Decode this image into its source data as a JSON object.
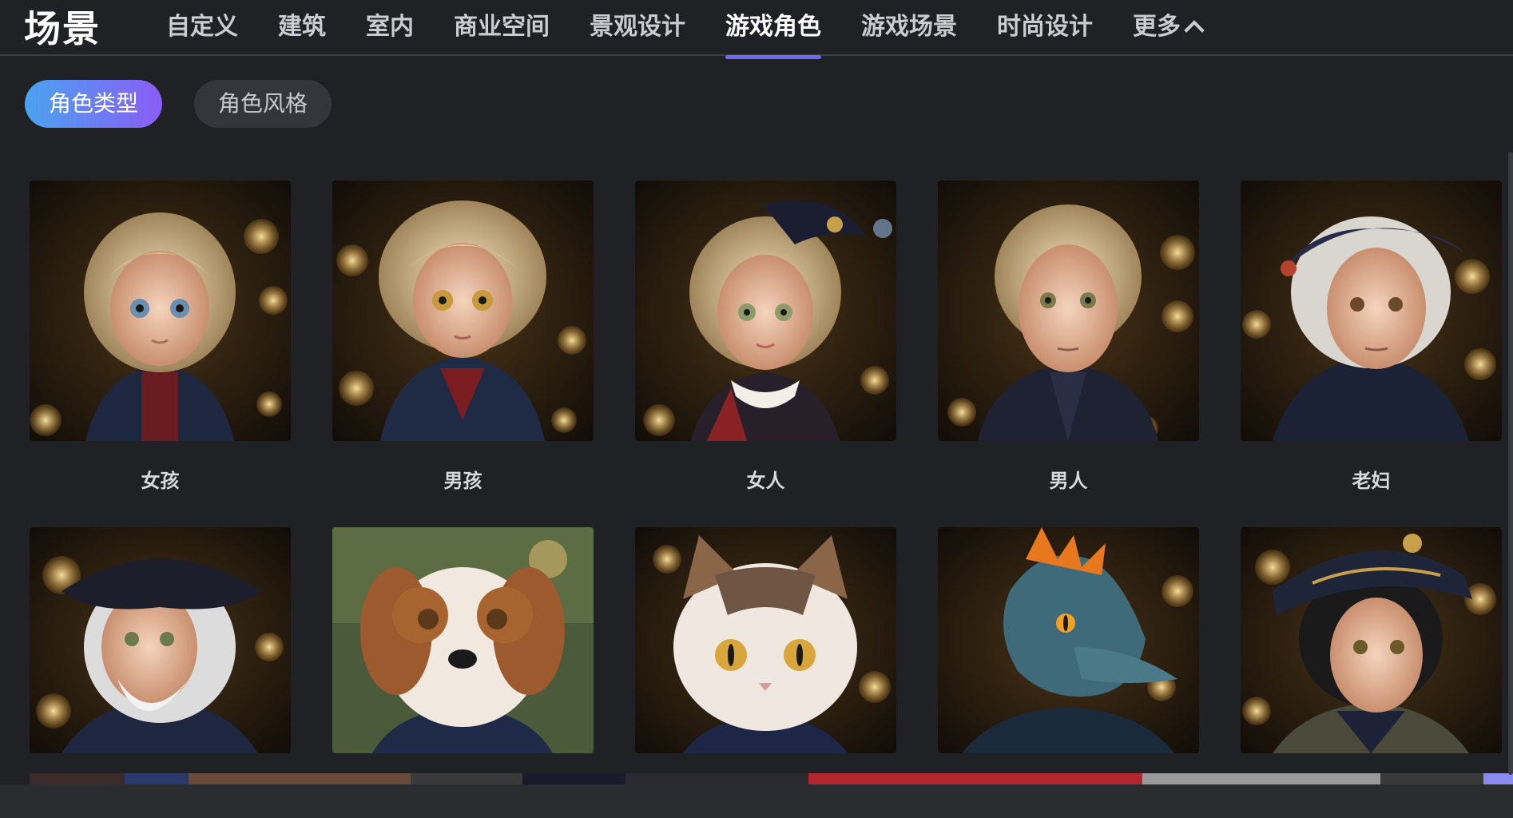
{
  "header": {
    "title": "场景",
    "tabs": [
      {
        "label": "自定义",
        "active": false
      },
      {
        "label": "建筑",
        "active": false
      },
      {
        "label": "室内",
        "active": false
      },
      {
        "label": "商业空间",
        "active": false
      },
      {
        "label": "景观设计",
        "active": false
      },
      {
        "label": "游戏角色",
        "active": true
      },
      {
        "label": "游戏场景",
        "active": false
      },
      {
        "label": "时尚设计",
        "active": false
      },
      {
        "label": "更多",
        "active": false
      }
    ],
    "accent": "#6b6cf6"
  },
  "filters": [
    {
      "label": "角色类型",
      "active": true
    },
    {
      "label": "角色风格",
      "active": false
    }
  ],
  "cards_row1": [
    {
      "label": "女孩",
      "subject": "girl-portrait"
    },
    {
      "label": "男孩",
      "subject": "boy-portrait"
    },
    {
      "label": "女人",
      "subject": "woman-portrait"
    },
    {
      "label": "男人",
      "subject": "man-portrait"
    },
    {
      "label": "老妇",
      "subject": "old-woman-portrait"
    }
  ],
  "cards_row2": [
    {
      "subject": "old-man-portrait"
    },
    {
      "subject": "dog-portrait"
    },
    {
      "subject": "cat-portrait"
    },
    {
      "subject": "dragon-portrait"
    },
    {
      "subject": "soldier-portrait"
    }
  ]
}
